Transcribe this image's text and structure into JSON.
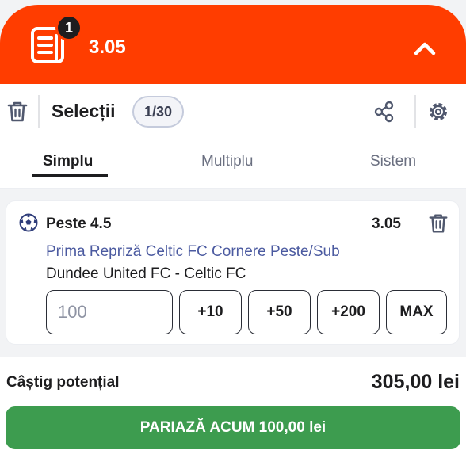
{
  "header": {
    "selection_count": "1",
    "total_odds": "3.05",
    "accent_color": "#ff3d00",
    "collapse_icon": "chevron-up-icon"
  },
  "toolbar": {
    "title": "Selecții",
    "counter": "1/30",
    "icons": [
      "trash-icon",
      "share-icon",
      "gear-icon"
    ]
  },
  "tabs": [
    {
      "label": "Simplu",
      "active": true
    },
    {
      "label": "Multiplu",
      "active": false
    },
    {
      "label": "Sistem",
      "active": false
    }
  ],
  "bet": {
    "pick": "Peste 4.5",
    "odds": "3.05",
    "market": "Prima Repriză Celtic FC Cornere Peste/Sub",
    "match": "Dundee United FC - Celtic FC",
    "stake_placeholder": "100",
    "quick_stakes": [
      "+10",
      "+50",
      "+200",
      "MAX"
    ]
  },
  "summary": {
    "win_label": "Câștig potențial",
    "win_amount": "305,00 lei",
    "place_button": "PARIAZĂ ACUM 100,00 lei",
    "button_color": "#3d9c4f"
  }
}
